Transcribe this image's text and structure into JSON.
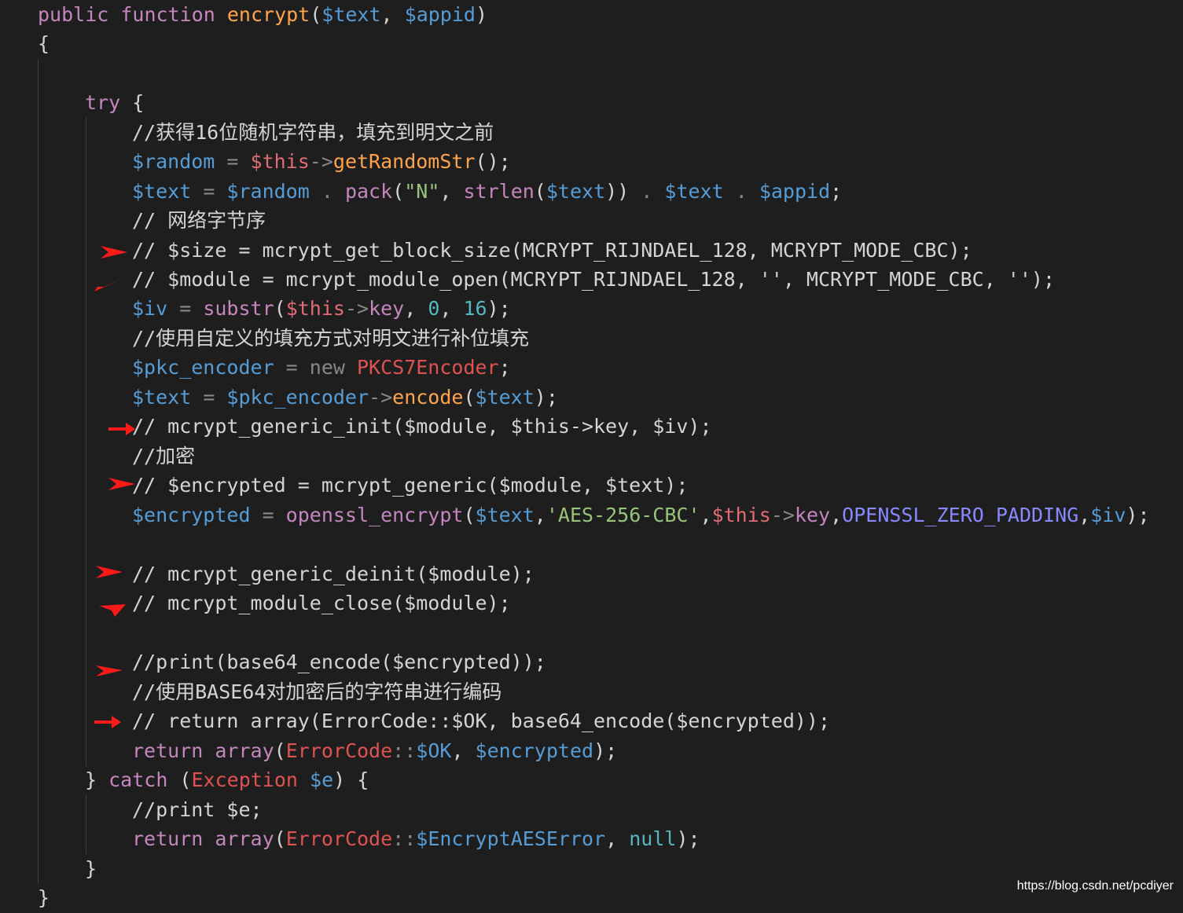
{
  "colors": {
    "background": "#1e1e1e",
    "default": "#d4d4d4",
    "keyword": "#c586c0",
    "function": "#ffa44a",
    "variable": "#569cd6",
    "this": "#e06c75",
    "builtin": "#c586c0",
    "string": "#98c379",
    "number": "#56b6c2",
    "comment": "#d4d4d4",
    "class": "#e05252",
    "constant": "#8888ff",
    "operator": "#888888",
    "arrow": "#ff1a1a"
  },
  "watermark": "https://blog.csdn.net/pcdiyer",
  "lines": [
    [
      [
        "keyword",
        "public"
      ],
      [
        "default",
        " "
      ],
      [
        "keyword",
        "function"
      ],
      [
        "default",
        " "
      ],
      [
        "function",
        "encrypt"
      ],
      [
        "default",
        "("
      ],
      [
        "variable",
        "$text"
      ],
      [
        "default",
        ", "
      ],
      [
        "variable",
        "$appid"
      ],
      [
        "default",
        ")"
      ]
    ],
    [
      [
        "default",
        "{"
      ]
    ],
    [],
    [
      [
        "keyword",
        "try"
      ],
      [
        "default",
        " {"
      ]
    ],
    [
      [
        "comment",
        "//获得16位随机字符串，填充到明文之前"
      ]
    ],
    [
      [
        "variable",
        "$random"
      ],
      [
        "operator",
        " = "
      ],
      [
        "this",
        "$this"
      ],
      [
        "operator",
        "->"
      ],
      [
        "function",
        "getRandomStr"
      ],
      [
        "default",
        "();"
      ]
    ],
    [
      [
        "variable",
        "$text"
      ],
      [
        "operator",
        " = "
      ],
      [
        "variable",
        "$random"
      ],
      [
        "operator",
        " . "
      ],
      [
        "builtin",
        "pack"
      ],
      [
        "default",
        "("
      ],
      [
        "string",
        "\"N\""
      ],
      [
        "default",
        ", "
      ],
      [
        "builtin",
        "strlen"
      ],
      [
        "default",
        "("
      ],
      [
        "variable",
        "$text"
      ],
      [
        "default",
        "))"
      ],
      [
        "operator",
        " . "
      ],
      [
        "variable",
        "$text"
      ],
      [
        "operator",
        " . "
      ],
      [
        "variable",
        "$appid"
      ],
      [
        "default",
        ";"
      ]
    ],
    [
      [
        "comment",
        "// 网络字节序"
      ]
    ],
    [
      [
        "comment",
        "// $size = mcrypt_get_block_size(MCRYPT_RIJNDAEL_128, MCRYPT_MODE_CBC);"
      ]
    ],
    [
      [
        "comment",
        "// $module = mcrypt_module_open(MCRYPT_RIJNDAEL_128, '', MCRYPT_MODE_CBC, '');"
      ]
    ],
    [
      [
        "variable",
        "$iv"
      ],
      [
        "operator",
        " = "
      ],
      [
        "builtin",
        "substr"
      ],
      [
        "default",
        "("
      ],
      [
        "this",
        "$this"
      ],
      [
        "operator",
        "->"
      ],
      [
        "builtin",
        "key"
      ],
      [
        "default",
        ", "
      ],
      [
        "number",
        "0"
      ],
      [
        "default",
        ", "
      ],
      [
        "number",
        "16"
      ],
      [
        "default",
        ");"
      ]
    ],
    [
      [
        "comment",
        "//使用自定义的填充方式对明文进行补位填充"
      ]
    ],
    [
      [
        "variable",
        "$pkc_encoder"
      ],
      [
        "operator",
        " = new "
      ],
      [
        "class",
        "PKCS7Encoder"
      ],
      [
        "default",
        ";"
      ]
    ],
    [
      [
        "variable",
        "$text"
      ],
      [
        "operator",
        " = "
      ],
      [
        "variable",
        "$pkc_encoder"
      ],
      [
        "operator",
        "->"
      ],
      [
        "function",
        "encode"
      ],
      [
        "default",
        "("
      ],
      [
        "variable",
        "$text"
      ],
      [
        "default",
        ");"
      ]
    ],
    [
      [
        "comment",
        "// mcrypt_generic_init($module, $this->key, $iv);"
      ]
    ],
    [
      [
        "comment",
        "//加密"
      ]
    ],
    [
      [
        "comment",
        "// $encrypted = mcrypt_generic($module, $text);"
      ]
    ],
    [
      [
        "variable",
        "$encrypted"
      ],
      [
        "operator",
        " = "
      ],
      [
        "builtin",
        "openssl_encrypt"
      ],
      [
        "default",
        "("
      ],
      [
        "variable",
        "$text"
      ],
      [
        "default",
        ","
      ],
      [
        "string",
        "'AES-256-CBC'"
      ],
      [
        "default",
        ","
      ],
      [
        "this",
        "$this"
      ],
      [
        "operator",
        "->"
      ],
      [
        "builtin",
        "key"
      ],
      [
        "default",
        ","
      ],
      [
        "constant",
        "OPENSSL_ZERO_PADDING"
      ],
      [
        "default",
        ","
      ],
      [
        "variable",
        "$iv"
      ],
      [
        "default",
        ");"
      ]
    ],
    [],
    [
      [
        "comment",
        "// mcrypt_generic_deinit($module);"
      ]
    ],
    [
      [
        "comment",
        "// mcrypt_module_close($module);"
      ]
    ],
    [],
    [
      [
        "comment",
        "//print(base64_encode($encrypted));"
      ]
    ],
    [
      [
        "comment",
        "//使用BASE64对加密后的字符串进行编码"
      ]
    ],
    [
      [
        "comment",
        "// return array(ErrorCode::$OK, base64_encode($encrypted));"
      ]
    ],
    [
      [
        "builtin",
        "return"
      ],
      [
        "default",
        " "
      ],
      [
        "builtin",
        "array"
      ],
      [
        "default",
        "("
      ],
      [
        "class",
        "ErrorCode"
      ],
      [
        "operator",
        "::"
      ],
      [
        "variable",
        "$OK"
      ],
      [
        "default",
        ", "
      ],
      [
        "variable",
        "$encrypted"
      ],
      [
        "default",
        ");"
      ]
    ],
    [
      [
        "default",
        "} "
      ],
      [
        "keyword",
        "catch"
      ],
      [
        "default",
        " ("
      ],
      [
        "class",
        "Exception"
      ],
      [
        "default",
        " "
      ],
      [
        "variable",
        "$e"
      ],
      [
        "default",
        ") {"
      ]
    ],
    [
      [
        "comment",
        "//print $e;"
      ]
    ],
    [
      [
        "builtin",
        "return"
      ],
      [
        "default",
        " "
      ],
      [
        "builtin",
        "array"
      ],
      [
        "default",
        "("
      ],
      [
        "class",
        "ErrorCode"
      ],
      [
        "operator",
        "::"
      ],
      [
        "variable",
        "$EncryptAESError"
      ],
      [
        "default",
        ", "
      ],
      [
        "number",
        "null"
      ],
      [
        "default",
        ");"
      ]
    ],
    [
      [
        "default",
        "}"
      ]
    ],
    [
      [
        "default",
        "}"
      ]
    ]
  ]
}
